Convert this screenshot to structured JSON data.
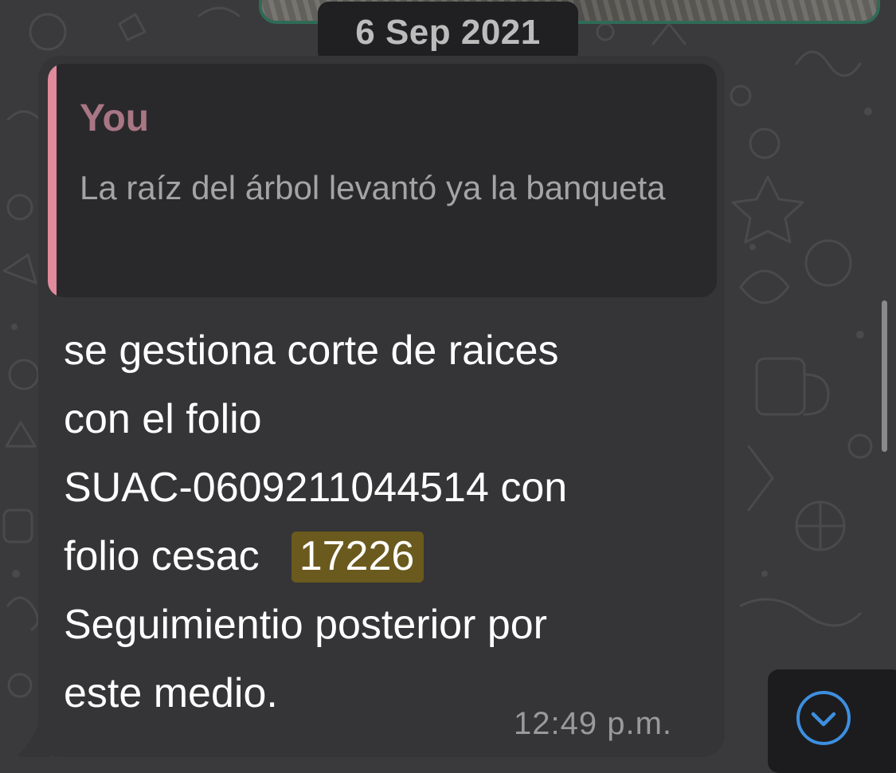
{
  "date_separator": "6 Sep 2021",
  "message": {
    "quoted": {
      "author": "You",
      "text": "La raíz del árbol levantó ya la banqueta"
    },
    "body": {
      "line_1": "se gestiona corte de raices",
      "line_2": "con el folio",
      "line_3": "SUAC-0609211044514 con",
      "line_4_prefix": "folio cesac",
      "highlighted_number": "17226",
      "line_5": "Seguimientio posterior por",
      "line_6": "este medio."
    },
    "time": "12:49 p.m."
  },
  "icons": {
    "scroll_down": "chevron-down-circle-icon"
  },
  "colors": {
    "background": "#3a3a3c",
    "bubble": "#353537",
    "quote_bar": "#e08a9c",
    "quote_author": "#a97684",
    "highlight": "#6b5a1d",
    "accent_blue": "#3d8fe0"
  }
}
